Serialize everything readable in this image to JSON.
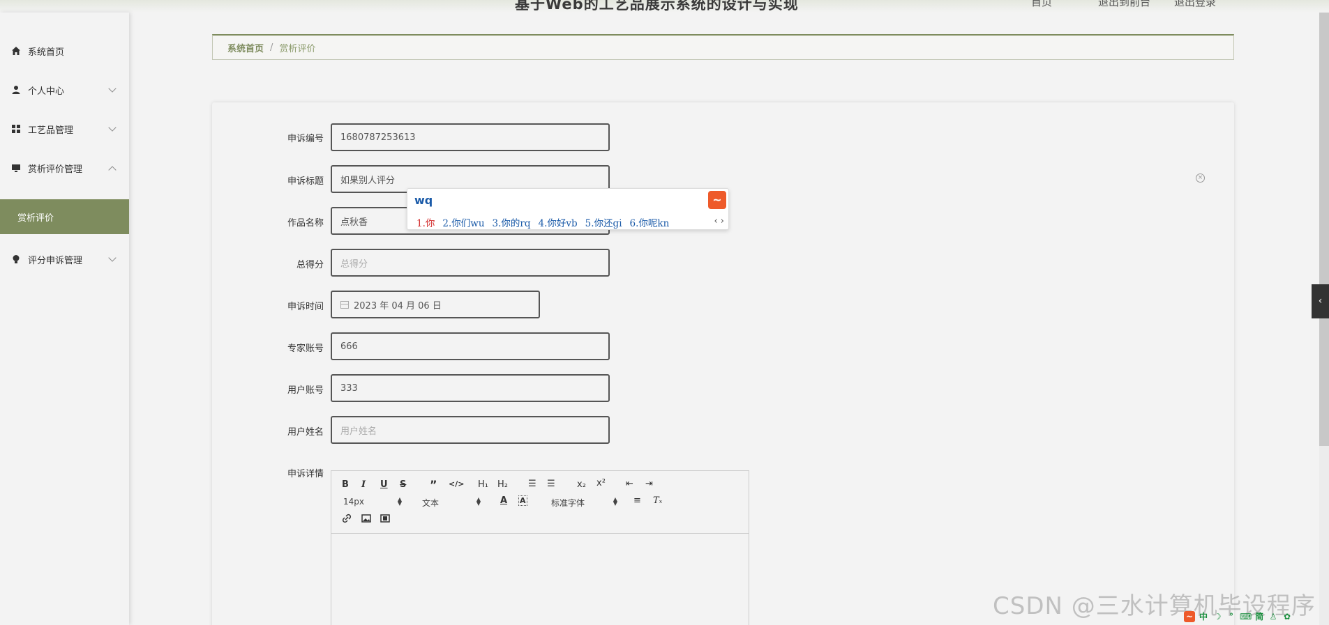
{
  "header": {
    "title": "基于Web的工艺品展示系统的设计与实现",
    "link1": "首页",
    "link2": "退出到前台",
    "link3": "退出登录"
  },
  "sidebar": {
    "items": [
      {
        "label": "系统首页",
        "icon": "home-icon"
      },
      {
        "label": "个人中心",
        "icon": "user-icon"
      },
      {
        "label": "工艺品管理",
        "icon": "grid-icon"
      },
      {
        "label": "赏析评价管理",
        "icon": "monitor-icon"
      },
      {
        "label": "评分申诉管理",
        "icon": "bulb-icon"
      }
    ],
    "submenu_active": "赏析评价"
  },
  "breadcrumb": {
    "home": "系统首页",
    "separator": "/",
    "current": "赏析评价"
  },
  "form": {
    "appeal_no": {
      "label": "申诉编号",
      "value": "1680787253613"
    },
    "appeal_title": {
      "label": "申诉标题",
      "value": "如果别人评分"
    },
    "work_name": {
      "label": "作品名称",
      "value": "点秋香"
    },
    "total_score": {
      "label": "总得分",
      "placeholder": "总得分"
    },
    "appeal_time": {
      "label": "申诉时间",
      "value": "2023 年 04 月 06 日"
    },
    "expert_account": {
      "label": "专家账号",
      "value": "666"
    },
    "user_account": {
      "label": "用户账号",
      "value": "333"
    },
    "user_name": {
      "label": "用户姓名",
      "placeholder": "用户姓名"
    },
    "appeal_detail": {
      "label": "申诉详情"
    }
  },
  "editor": {
    "font_size": "14px",
    "text_style": "文本",
    "font_family": "标准字体"
  },
  "ime": {
    "composition": "wq",
    "candidates": [
      "1.你",
      "2.你们wu",
      "3.你的rq",
      "4.你好vb",
      "5.你还gi",
      "6.你呢kn"
    ]
  },
  "watermark": "CSDN @三水计算机毕设程序"
}
